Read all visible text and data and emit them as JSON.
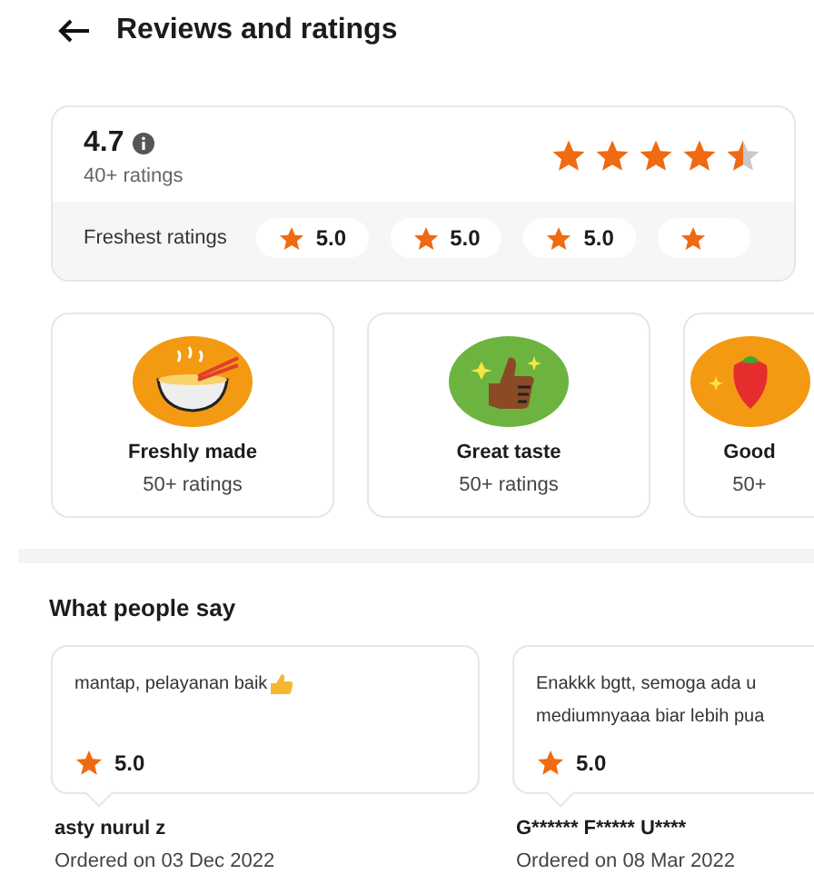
{
  "header": {
    "title": "Reviews and ratings"
  },
  "summary": {
    "score": "4.7",
    "count": "40+ ratings",
    "stars": 4.5,
    "freshest_label": "Freshest ratings",
    "freshest": [
      {
        "kind": "full",
        "rating": "5.0"
      },
      {
        "kind": "full",
        "rating": "5.0"
      },
      {
        "kind": "full",
        "rating": "5.0"
      },
      {
        "kind": "cut"
      }
    ]
  },
  "highlights": [
    {
      "kind": "bowl",
      "title": "Freshly made",
      "count": "50+ ratings"
    },
    {
      "kind": "thumb",
      "title": "Great taste",
      "count": "50+ ratings"
    },
    {
      "kind": "fruit",
      "title": "Good",
      "count": "50+"
    }
  ],
  "reviews_title": "What people say",
  "reviews": [
    {
      "lines": [
        "mantap, pelayanan baik"
      ],
      "thumb": true,
      "rating": "5.0",
      "name": "asty nurul z",
      "date": "Ordered on 03 Dec 2022"
    },
    {
      "lines": [
        "Enakkk bgtt, semoga ada u",
        "mediumnyaaa biar lebih pua"
      ],
      "thumb": false,
      "rating": "5.0",
      "name": "G****** F***** U****",
      "date": "Ordered on 08 Mar 2022"
    }
  ]
}
